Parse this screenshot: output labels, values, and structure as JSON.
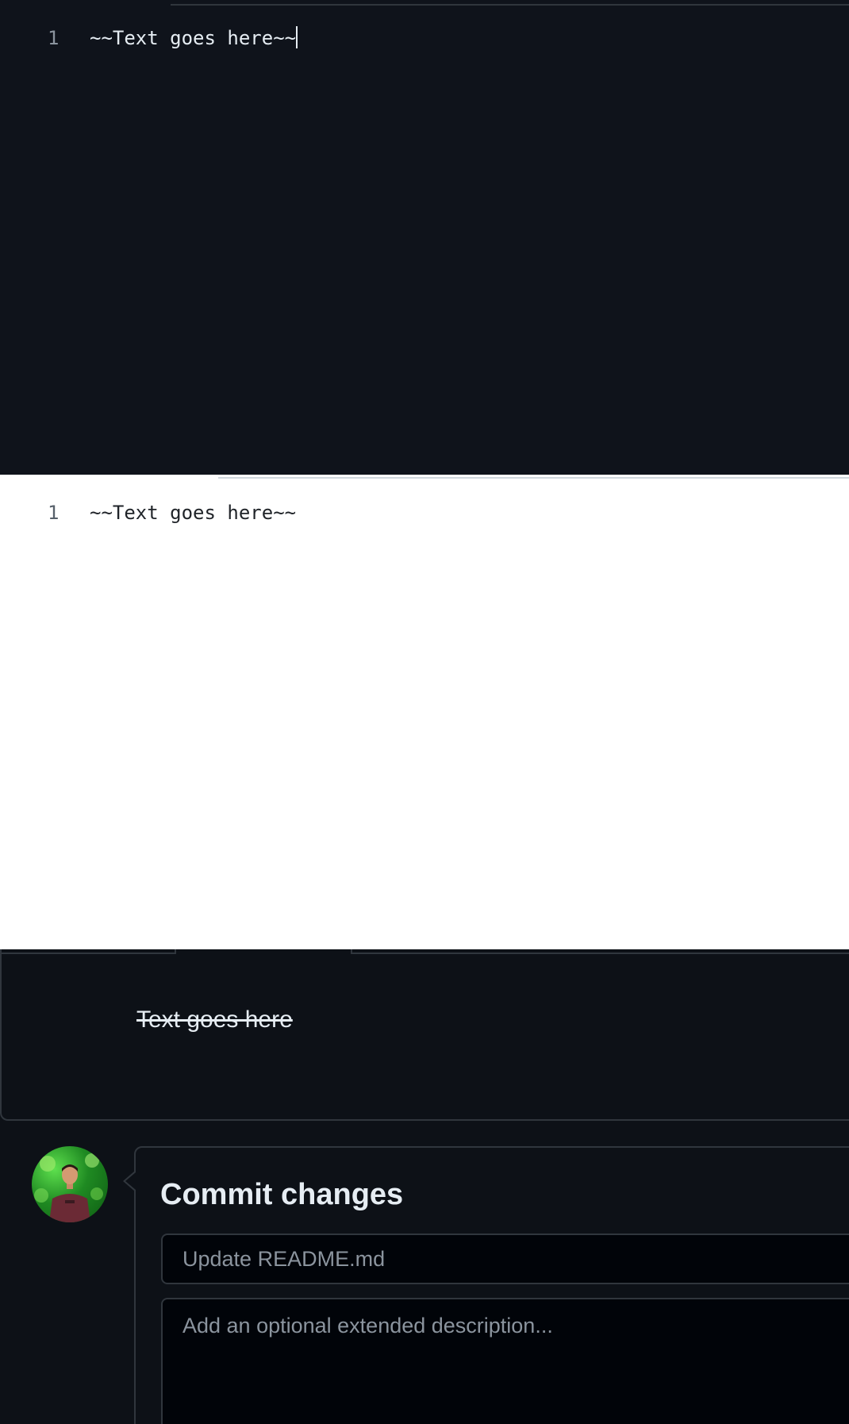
{
  "editor_dark": {
    "line_number": "1",
    "code": "~~Text goes here~~"
  },
  "editor_light": {
    "line_number": "1",
    "code": "~~Text goes here~~"
  },
  "preview": {
    "rendered_text": "Text goes here"
  },
  "commit": {
    "title": "Commit changes",
    "summary_placeholder": "Update README.md",
    "description_placeholder": "Add an optional extended description..."
  },
  "icons": {
    "avatar": "user-avatar-photo"
  },
  "colors": {
    "dark_bg": "#0f131b",
    "preview_bg": "#0d1117",
    "border": "#30363d",
    "text_light": "#e6edf3",
    "muted": "#8b949e",
    "input_bg": "#010409"
  }
}
